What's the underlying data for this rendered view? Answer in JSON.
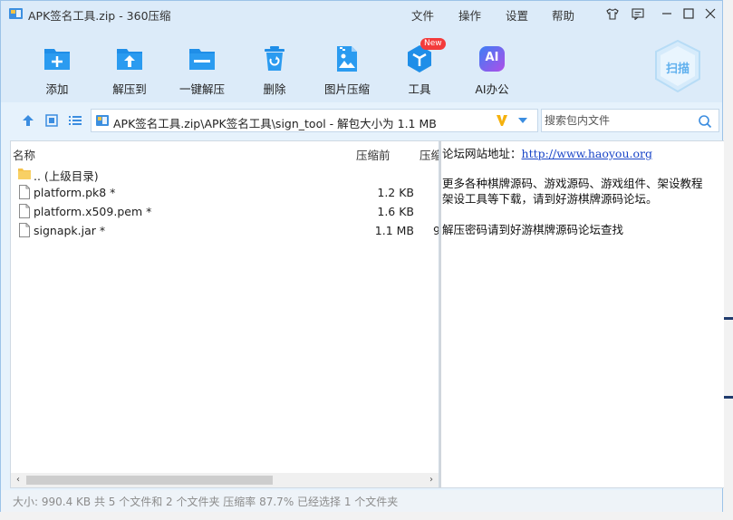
{
  "window": {
    "title": "APK签名工具.zip - 360压缩",
    "menu": [
      "文件",
      "操作",
      "设置",
      "帮助"
    ]
  },
  "toolbar": {
    "items": [
      {
        "label": "添加",
        "icon": "add-icon"
      },
      {
        "label": "解压到",
        "icon": "extract-to-icon"
      },
      {
        "label": "一键解压",
        "icon": "one-click-extract-icon"
      },
      {
        "label": "删除",
        "icon": "delete-icon"
      },
      {
        "label": "图片压缩",
        "icon": "image-compress-icon"
      },
      {
        "label": "工具",
        "icon": "tools-icon"
      },
      {
        "label": "AI办公",
        "icon": "ai-office-icon"
      }
    ],
    "new_badge": "New",
    "ai_icon_text": "AI",
    "scan_label": "扫描"
  },
  "nav": {
    "path": "APK签名工具.zip\\APK签名工具\\sign_tool - 解包大小为 1.1 MB",
    "search_placeholder": "搜索包内文件"
  },
  "filelist": {
    "columns": {
      "name": "名称",
      "packed": "压缩前",
      "ratio": "压缩"
    },
    "rows": [
      {
        "name": ".. (上级目录)",
        "size": "",
        "extra": "",
        "type": "folder"
      },
      {
        "name": "platform.pk8 *",
        "size": "1.2 KB",
        "extra": "",
        "type": "file"
      },
      {
        "name": "platform.x509.pem *",
        "size": "1.6 KB",
        "extra": "",
        "type": "file"
      },
      {
        "name": "signapk.jar *",
        "size": "1.1 MB",
        "extra": "9",
        "type": "file"
      }
    ]
  },
  "comment": {
    "line1_label": "论坛网站地址：",
    "line1_url": "http://www.haoyou.org",
    "line2": "更多各种棋牌源码、游戏源码、游戏组件、架设教程",
    "line3": "架设工具等下载，请到好游棋牌源码论坛。",
    "line4": "解压密码请到好游棋牌源码论坛查找"
  },
  "status": {
    "text": "大小: 990.4 KB 共 5 个文件和 2 个文件夹 压缩率 87.7% 已经选择 1 个文件夹"
  },
  "colors": {
    "accent": "#1f8ee8",
    "window_bg": "#dcebf9"
  }
}
